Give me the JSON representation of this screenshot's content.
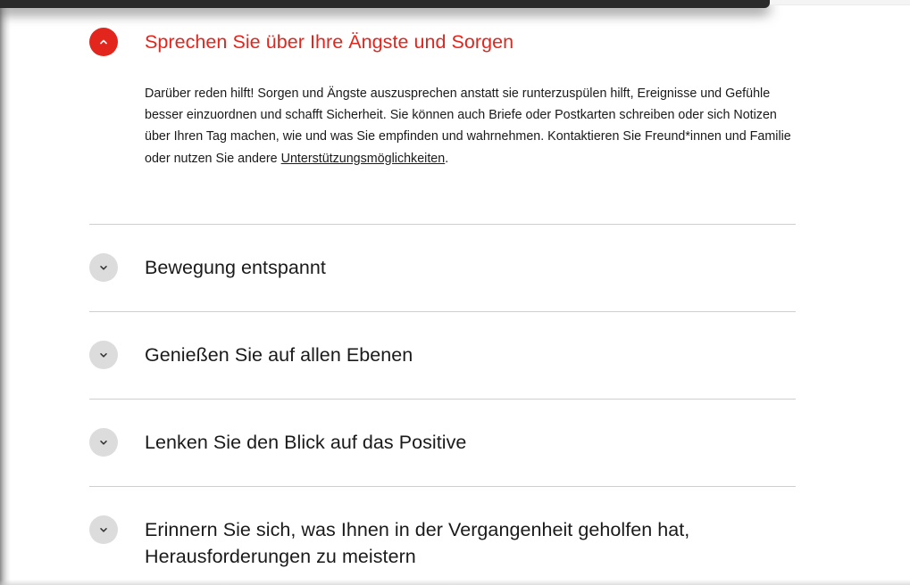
{
  "accordion": {
    "open_item": {
      "title": "Sprechen Sie über Ihre Ängste und Sorgen",
      "body_before_link": "Darüber reden hilft! Sorgen und Ängste auszusprechen anstatt sie runterzuspülen hilft, Ereignisse und Gefühle besser einzuordnen und schafft Sicherheit. Sie können auch Briefe oder Postkarten schreiben oder sich Notizen über Ihren Tag machen, wie und was Sie empfinden und wahrnehmen. Kontaktieren Sie Freund*innen und Familie oder nutzen Sie andere ",
      "link_text": "Unterstützungsmöglichkeiten",
      "body_after_link": ".",
      "toggle_icon": "chevron-up-icon"
    },
    "items": [
      {
        "title": "Bewegung entspannt",
        "toggle_icon": "chevron-down-icon"
      },
      {
        "title": "Genießen Sie auf allen Ebenen",
        "toggle_icon": "chevron-down-icon"
      },
      {
        "title": "Lenken Sie den Blick auf das Positive",
        "toggle_icon": "chevron-down-icon"
      },
      {
        "title": "Erinnern Sie sich, was Ihnen in der Vergangenheit geholfen hat, Herausforderungen zu meistern",
        "toggle_icon": "chevron-down-icon"
      }
    ]
  },
  "colors": {
    "accent": "#e2251d",
    "toggle_closed": "#dcdcdc",
    "divider": "#cfcfcf",
    "text": "#1a1a1a"
  }
}
